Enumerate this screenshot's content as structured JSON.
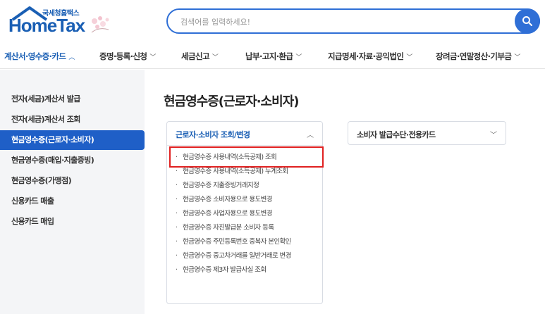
{
  "header": {
    "logo_sub": "국세청홈택스",
    "logo_main": "HomeTax",
    "search_placeholder": "검색어를 입력하세요!",
    "brand_color": "#1a5fb4",
    "accent_color": "#2f6fd6"
  },
  "nav": {
    "items": [
      {
        "label": "계산서·영수증·카드",
        "chevron": "^",
        "active": true
      },
      {
        "label": "증명·등록·신청",
        "chevron": "v"
      },
      {
        "label": "세금신고",
        "chevron": "v"
      },
      {
        "label": "납부·고지·환급",
        "chevron": "v"
      },
      {
        "label": "지급명세·자료·공익법인",
        "chevron": "v"
      },
      {
        "label": "장려금·연말정산·기부금",
        "chevron": "v"
      }
    ]
  },
  "sidebar": {
    "items": [
      {
        "label": "전자(세금)계산서 발급"
      },
      {
        "label": "전자(세금)계산서 조회"
      },
      {
        "label": "현금영수증(근로자·소비자)",
        "active": true
      },
      {
        "label": "현금영수증(매입·지출증빙)"
      },
      {
        "label": "현금영수증(가맹점)"
      },
      {
        "label": "신용카드 매출"
      },
      {
        "label": "신용카드 매입"
      }
    ],
    "active_color": "#1f5fc7"
  },
  "main": {
    "title": "현금영수증(근로자·소비자)",
    "left_panel": {
      "label": "근로자·소비자 조회/변경",
      "chevron": "^",
      "links": [
        "현금영수증 사용내역(소득공제) 조회",
        "현금영수증 사용내역(소득공제) 누계조회",
        "현금영수증 지출증빙거래지정",
        "현금영수증 소비자용으로 용도변경",
        "현금영수증 사업자용으로 용도변경",
        "현금영수증 자진발급분 소비자 등록",
        "현금영수증 주민등록번호 중복자 본인확인",
        "현금영수증 중고차거래를 일반거래로 변경",
        "현금영수증 제3자 발급사실 조회"
      ]
    },
    "right_panel": {
      "label": "소비자 발급수단·전용카드",
      "chevron": "v"
    },
    "highlight_color": "#e02020"
  },
  "icons": {
    "search": "search-icon",
    "logo_roof": "house-roof-icon",
    "logo_flower": "cherry-blossom-icon"
  }
}
